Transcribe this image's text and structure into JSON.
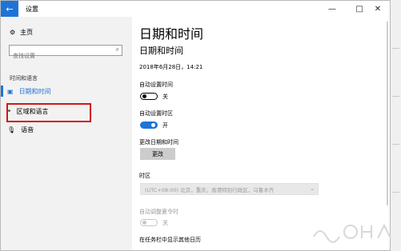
{
  "window": {
    "back_icon": "←",
    "title": "设置",
    "minimize": "—",
    "maximize": "□",
    "close": "✕"
  },
  "sidebar": {
    "home_icon": "⚙",
    "home_label": "主页",
    "search_placeholder": "查找设置",
    "search_icon": "⌕",
    "section_label": "时间和语言",
    "items": [
      {
        "icon": "▣",
        "label": "日期和时间",
        "selected": true
      },
      {
        "icon": "⌖",
        "label": "区域和语言",
        "selected": false
      },
      {
        "icon": "🎙",
        "label": "语音",
        "selected": false
      }
    ]
  },
  "main": {
    "page_title": "日期和时间",
    "sub_title": "日期和时间",
    "current_datetime": "2018年6月28日，14:21",
    "auto_time_label": "自动设置时间",
    "auto_time_state": "关",
    "auto_tz_label": "自动设置时区",
    "auto_tz_state": "开",
    "change_label": "更改日期和时间",
    "change_button": "更改",
    "timezone_label": "时区",
    "timezone_value": "(UTC+08:00) 北京，重庆，香港特别行政区，乌鲁木齐",
    "timezone_chevron": "⌄",
    "dst_label": "自动调整夏令时",
    "dst_state": "关",
    "extra_calendar_label": "在任务栏中显示其他日历"
  },
  "colors": {
    "accent": "#1e74d6",
    "highlight_box": "#d21515",
    "sidebar_bg": "#f2f2f2"
  }
}
